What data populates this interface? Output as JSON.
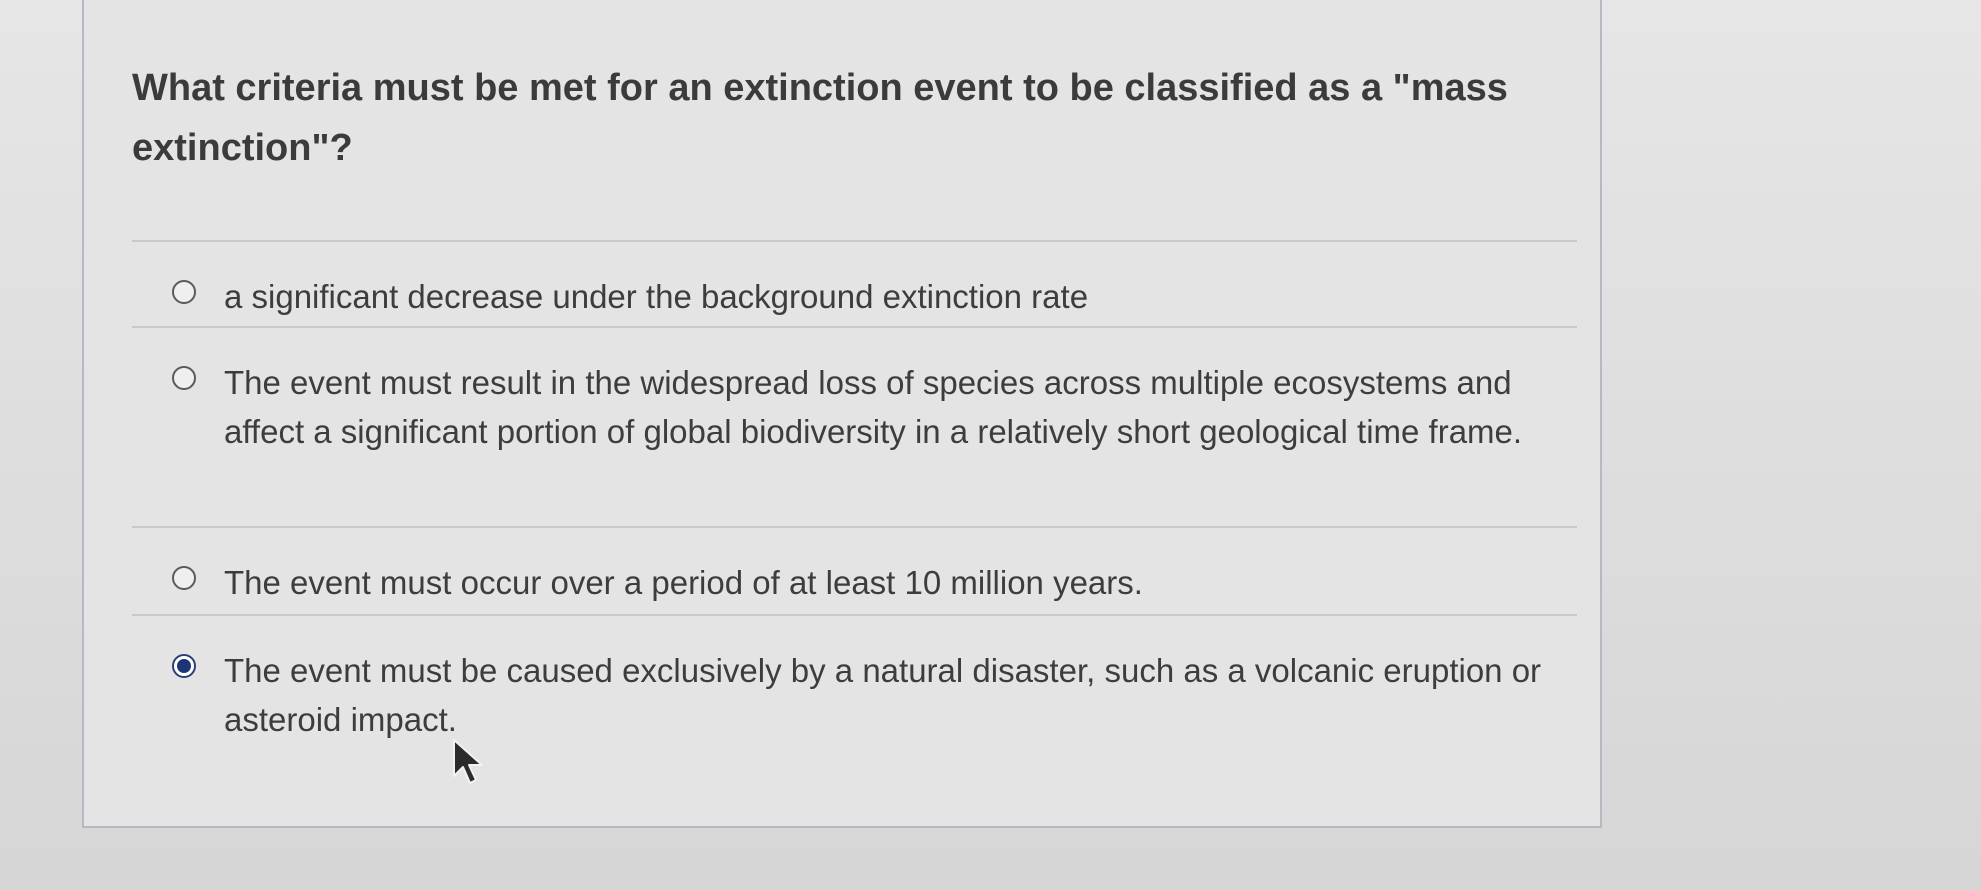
{
  "question": {
    "text": "What criteria must be met for an extinction event to be classified as a \"mass extinction\"?"
  },
  "options": [
    {
      "label": "a significant decrease under the background extinction rate",
      "selected": false
    },
    {
      "label": "The event must result in the widespread loss of species across multiple ecosystems and affect a significant portion of global biodiversity in a relatively short geological time frame.",
      "selected": false
    },
    {
      "label": "The event must occur over a period of at least 10 million years.",
      "selected": false
    },
    {
      "label": "The event must be caused exclusively by a natural disaster, such as a volcanic eruption or asteroid impact.",
      "selected": true
    }
  ],
  "icons": {
    "cursor": "mouse-pointer-icon",
    "radio": "radio-button-icon"
  },
  "colors": {
    "selected_radio": "#1d3577",
    "text": "#3d3d3d",
    "divider": "#c8c8cf"
  }
}
